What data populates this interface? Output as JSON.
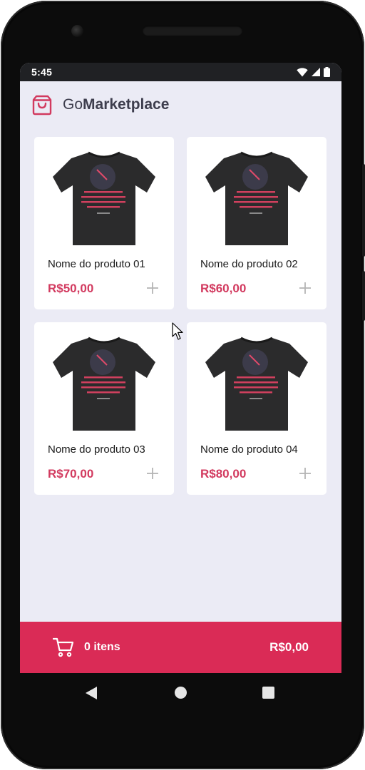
{
  "status_bar": {
    "time": "5:45",
    "icons": [
      "wifi-icon",
      "signal-icon",
      "battery-icon"
    ]
  },
  "header": {
    "title_light": "Go",
    "title_bold": "Marketplace",
    "icon": "shopping-bag-icon"
  },
  "products": [
    {
      "name": "Nome do produto 01",
      "price": "R$50,00"
    },
    {
      "name": "Nome do produto 02",
      "price": "R$60,00"
    },
    {
      "name": "Nome do produto 03",
      "price": "R$70,00"
    },
    {
      "name": "Nome do produto 04",
      "price": "R$80,00"
    }
  ],
  "cart": {
    "count_label": "0 itens",
    "total": "R$0,00",
    "icon": "shopping-cart-icon"
  },
  "navigation": {
    "buttons": [
      "back-icon",
      "home-icon",
      "recents-icon"
    ]
  },
  "colors": {
    "accent": "#D23A5F",
    "cart_bar": "#DA2B56",
    "background": "#EBEBF5",
    "title_text": "#3D3D4D"
  }
}
